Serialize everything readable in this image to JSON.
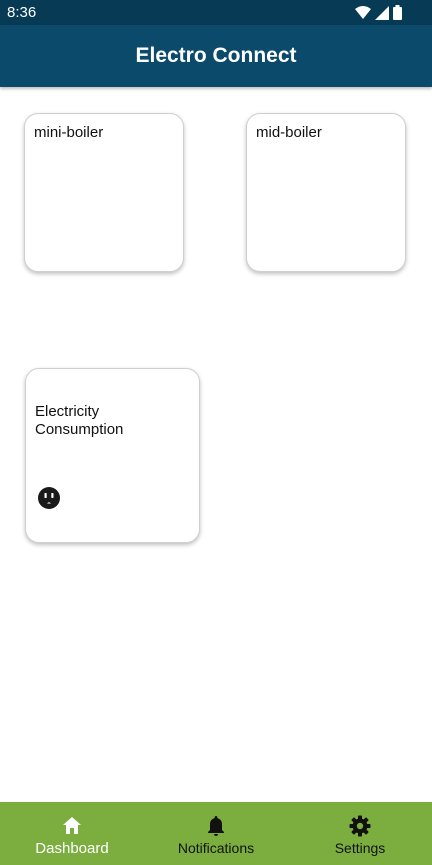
{
  "status_bar": {
    "time": "8:36",
    "icons": [
      "wifi-icon",
      "signal-icon",
      "battery-icon"
    ]
  },
  "app_bar": {
    "title": "Electro Connect",
    "color": "#0b4a6a"
  },
  "devices": [
    {
      "label": "mini-boiler"
    },
    {
      "label": "mid-boiler"
    }
  ],
  "electricity_card": {
    "label": "Electricity Consumption",
    "icon": "power-outlet-icon"
  },
  "bottom_nav": {
    "color": "#7cae3f",
    "items": [
      {
        "label": "Dashboard",
        "icon": "home-icon",
        "active": true
      },
      {
        "label": "Notifications",
        "icon": "bell-icon",
        "active": false
      },
      {
        "label": "Settings",
        "icon": "gear-icon",
        "active": false
      }
    ]
  }
}
